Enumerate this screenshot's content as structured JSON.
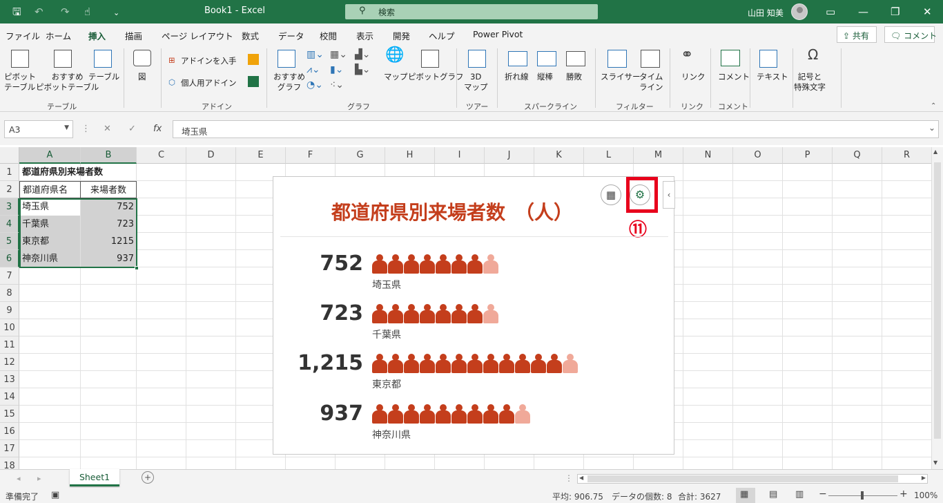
{
  "title_bar": {
    "doc_title": "Book1  -  Excel",
    "search_placeholder": "検索",
    "user_name": "山田 知美"
  },
  "tabs": [
    {
      "label": "ファイル"
    },
    {
      "label": "ホーム"
    },
    {
      "label": "挿入",
      "active": true
    },
    {
      "label": "描画"
    },
    {
      "label": "ページ レイアウト"
    },
    {
      "label": "数式"
    },
    {
      "label": "データ"
    },
    {
      "label": "校閲"
    },
    {
      "label": "表示"
    },
    {
      "label": "開発"
    },
    {
      "label": "ヘルプ"
    },
    {
      "label": "Power Pivot"
    }
  ],
  "share_label": "共有",
  "comment_label": "コメント",
  "ribbon": {
    "pivot_table": "ピボット\nテーブル",
    "recommended_pivot": "おすすめ\nピボットテーブル",
    "table": "テーブル",
    "illustrations": "図",
    "get_addins": "アドインを入手",
    "my_addins": "個人用アドイン",
    "recommended_charts": "おすすめ\nグラフ",
    "maps": "マップ",
    "pivot_chart": "ピボットグラフ",
    "map3d": "3D\nマップ",
    "line": "折れ線",
    "column": "縦棒",
    "winloss": "勝敗",
    "slicer": "スライサー",
    "timeline": "タイム\nライン",
    "link": "リンク",
    "comment": "コメント",
    "text": "テキスト",
    "symbols": "記号と\n特殊文字",
    "groups": {
      "table": "テーブル",
      "addins": "アドイン",
      "charts": "グラフ",
      "tours": "ツアー",
      "sparklines": "スパークライン",
      "filters": "フィルター",
      "links": "リンク",
      "comments": "コメント"
    }
  },
  "formula_bar": {
    "name_box": "A3",
    "formula": "埼玉県"
  },
  "columns": [
    "A",
    "B",
    "C",
    "D",
    "E",
    "F",
    "G",
    "H",
    "I",
    "J",
    "K",
    "L",
    "M",
    "N",
    "O",
    "P",
    "Q",
    "R"
  ],
  "rows": [
    "1",
    "2",
    "3",
    "4",
    "5",
    "6",
    "7",
    "8",
    "9",
    "10",
    "11",
    "12",
    "13",
    "14",
    "15",
    "16",
    "17",
    "18"
  ],
  "sheet": {
    "title": "都道府県別来場者数",
    "header_a": "都道府県名",
    "header_b": "来場者数",
    "data": [
      {
        "pref": "埼玉県",
        "count": "752"
      },
      {
        "pref": "千葉県",
        "count": "723"
      },
      {
        "pref": "東京都",
        "count": "1215"
      },
      {
        "pref": "神奈川県",
        "count": "937"
      }
    ]
  },
  "chart_data": {
    "type": "pictograph",
    "title": "都道府県別来場者数　（人）",
    "categories": [
      "埼玉県",
      "千葉県",
      "東京都",
      "神奈川県"
    ],
    "values": [
      752,
      723,
      1215,
      937
    ],
    "value_labels": [
      "752",
      "723",
      "1,215",
      "937"
    ],
    "icons_per_unit": 100,
    "icon_color": "#c43e1c",
    "partial_icon_color": "#f0a999"
  },
  "annotation_label": "⑪",
  "sheet_tab": "Sheet1",
  "status": {
    "ready": "準備完了",
    "average": "平均: 906.75",
    "count": "データの個数: 8",
    "sum": "合計: 3627",
    "zoom": "100%"
  },
  "colors": {
    "excel_green": "#217346",
    "annotation_red": "#e8001c"
  }
}
